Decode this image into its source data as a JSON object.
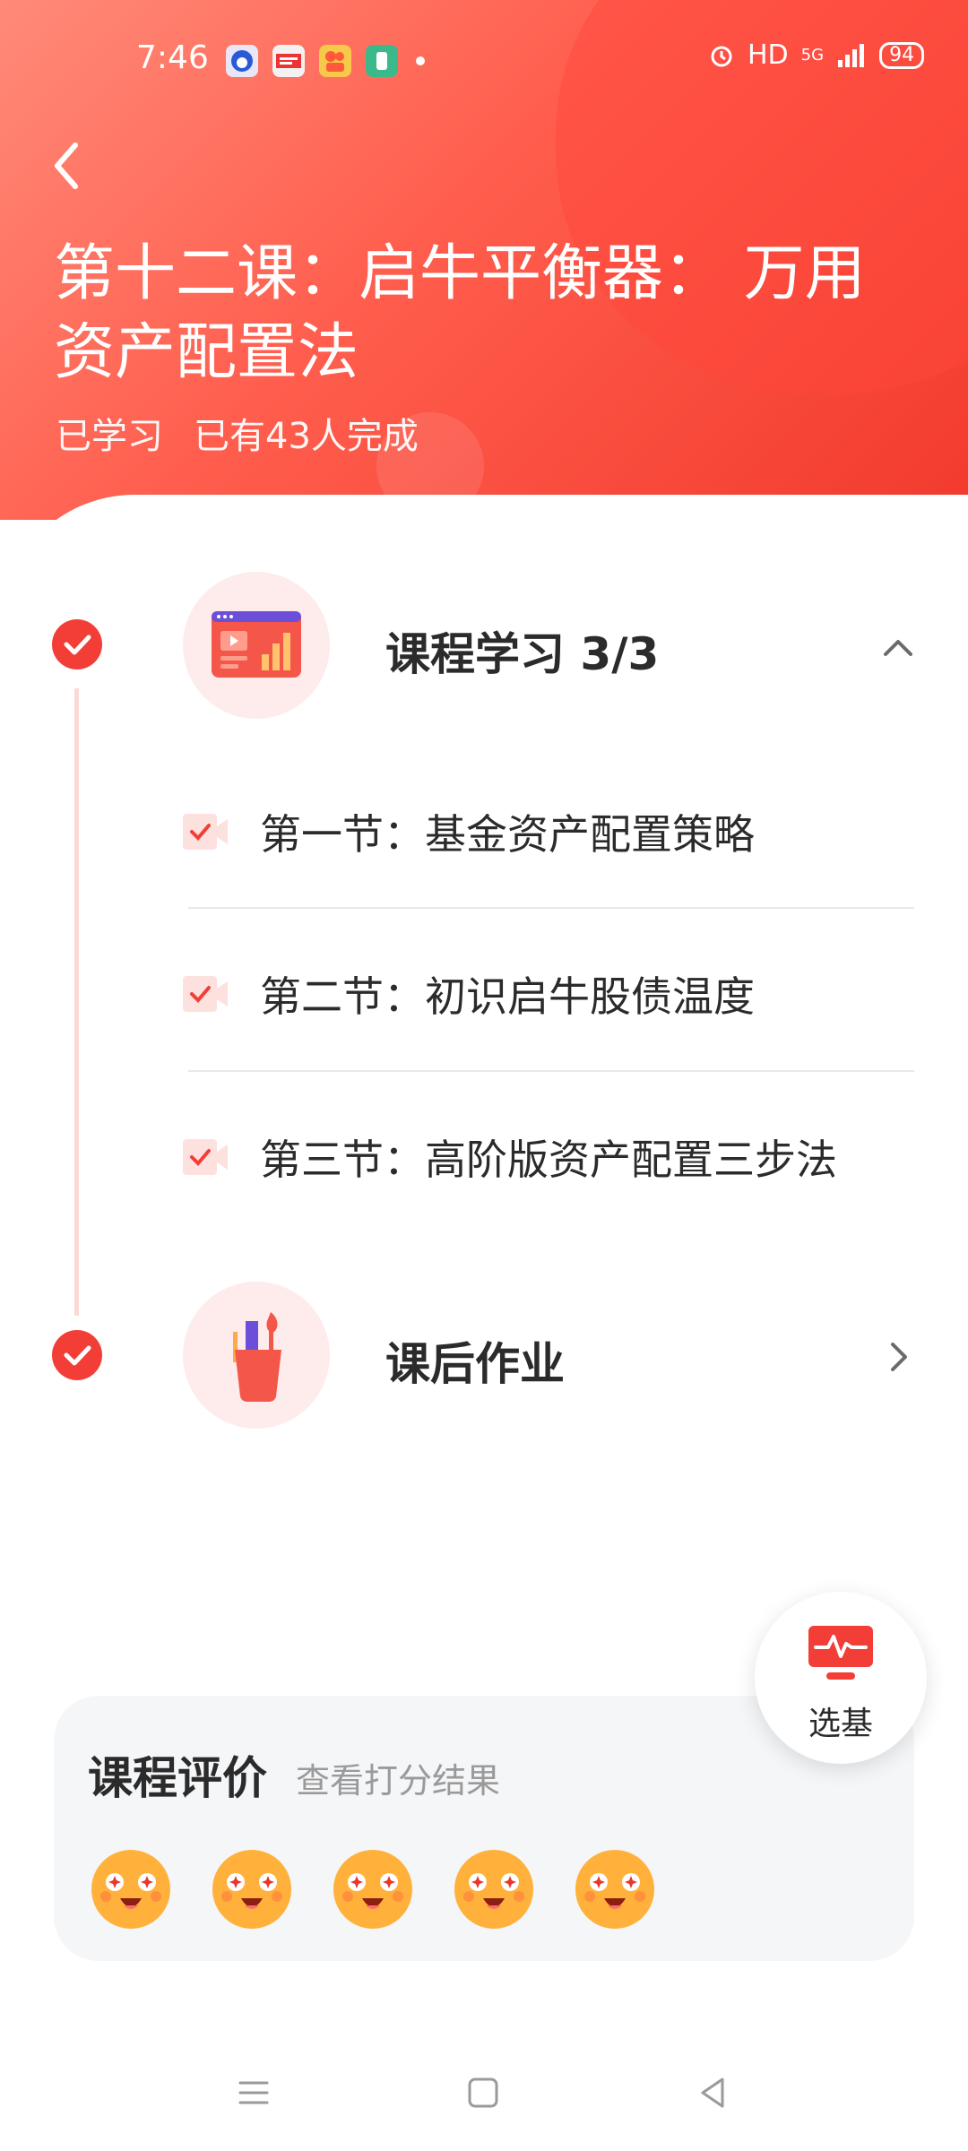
{
  "status_bar": {
    "time": "7:46",
    "network_label": "HD",
    "signal_label": "5G",
    "battery": "94"
  },
  "header": {
    "title": "第十二课：启牛平衡器： 万用资产配置法",
    "status": "已学习",
    "completions": "已有43人完成"
  },
  "course_study": {
    "label": "课程学习 3/3",
    "lessons": [
      {
        "label": "第一节：基金资产配置策略",
        "completed": true
      },
      {
        "label": "第二节：初识启牛股债温度",
        "completed": true
      },
      {
        "label": "第三节：高阶版资产配置三步法",
        "completed": true
      }
    ]
  },
  "homework": {
    "label": "课后作业"
  },
  "fab": {
    "label": "选基"
  },
  "evaluation": {
    "title": "课程评价",
    "link": "查看打分结果",
    "emoji_count": 5
  },
  "icons": {
    "back": "back-arrow-icon",
    "course": "presentation-chart-icon",
    "homework": "pen-holder-icon",
    "fab": "pulse-monitor-icon",
    "nav": [
      "menu-icon",
      "home-square-icon",
      "back-triangle-icon"
    ]
  },
  "colors": {
    "brand_red": "#f23e37",
    "header_gradient_start": "#ff8a78",
    "header_gradient_end": "#f23a2d",
    "completed_check_bg": "#f23e37",
    "card_bg": "#f5f6f8"
  }
}
